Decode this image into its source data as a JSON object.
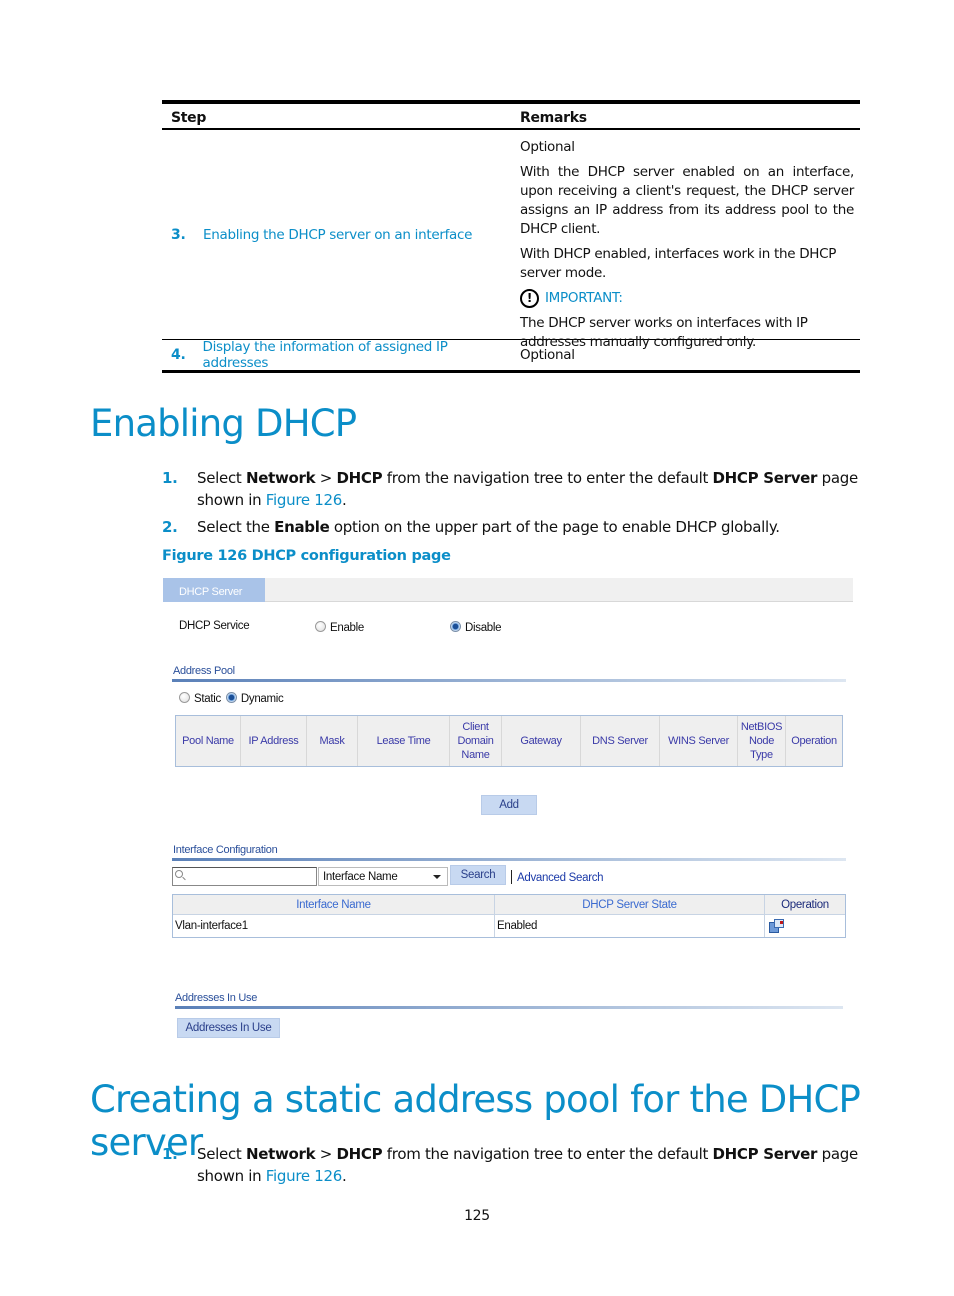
{
  "steps_table": {
    "headers": {
      "step": "Step",
      "remarks": "Remarks"
    },
    "rows": [
      {
        "number": "3.",
        "step_link": "Enabling the DHCP server on an interface",
        "remarks": {
          "optional": "Optional",
          "para1": "With the DHCP server enabled on an interface, upon receiving a client's request, the DHCP server assigns an IP address from its address pool to the DHCP client.",
          "para2": "With DHCP enabled, interfaces work in the DHCP server mode.",
          "important_label": "IMPORTANT:",
          "important_text": "The DHCP server works on interfaces with IP addresses manually configured only."
        }
      },
      {
        "number": "4.",
        "step_link": "Display the information of assigned IP addresses",
        "remarks": {
          "optional": "Optional"
        }
      }
    ]
  },
  "section1": {
    "title": "Enabling DHCP",
    "steps": [
      {
        "number": "1.",
        "t1": "Select ",
        "b1": "Network",
        "t2": " > ",
        "b2": "DHCP",
        "t3": " from the navigation tree to enter the default ",
        "b3": "DHCP Server",
        "t4": " page shown in ",
        "link": "Figure 126",
        "t5": "."
      },
      {
        "number": "2.",
        "t1": "Select the ",
        "b1": "Enable",
        "t2": " option on the upper part of the page to enable DHCP globally."
      }
    ],
    "figure_caption": "Figure 126 DHCP configuration page"
  },
  "figure": {
    "tab": "DHCP Server",
    "dhcp_service": {
      "label": "DHCP Service",
      "options": [
        {
          "label": "Enable",
          "selected": false
        },
        {
          "label": "Disable",
          "selected": true
        }
      ]
    },
    "address_pool": {
      "title": "Address Pool",
      "type_options": [
        {
          "label": "Static",
          "selected": false
        },
        {
          "label": "Dynamic",
          "selected": true
        }
      ],
      "columns": [
        "Pool Name",
        "IP Address",
        "Mask",
        "Lease Time",
        "Client Domain Name",
        "Gateway",
        "DNS Server",
        "WINS Server",
        "NetBIOS Node Type",
        "Operation"
      ],
      "add_button": "Add"
    },
    "interface_config": {
      "title": "Interface Configuration",
      "search_value": "",
      "search_field_selected": "Interface Name",
      "search_button": "Search",
      "advanced_search": "Advanced Search",
      "columns": [
        "Interface Name",
        "DHCP Server State",
        "Operation"
      ],
      "rows": [
        {
          "interface_name": "Vlan-interface1",
          "state": "Enabled",
          "operation_icon": "edit-icon"
        }
      ]
    },
    "addresses_in_use": {
      "title": "Addresses In Use",
      "button": "Addresses In Use"
    }
  },
  "section2": {
    "title": "Creating a static address pool for the DHCP server",
    "steps": [
      {
        "number": "1.",
        "t1": "Select ",
        "b1": "Network",
        "t2": " > ",
        "b2": "DHCP",
        "t3": " from the navigation tree to enter the default ",
        "b3": "DHCP Server",
        "t4": " page shown in ",
        "link": "Figure 126",
        "t5": "."
      }
    ]
  },
  "page_number": "125"
}
